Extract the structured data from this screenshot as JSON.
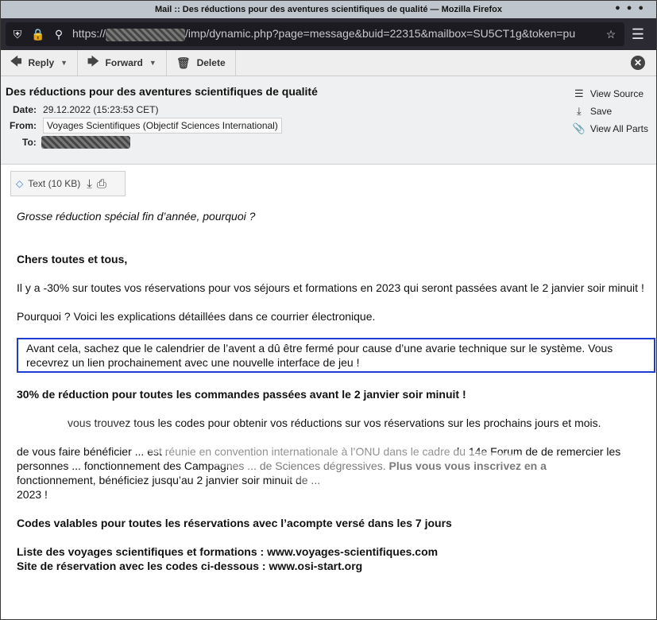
{
  "window": {
    "title": "Mail :: Des réductions pour des aventures scientifiques de qualité — Mozilla Firefox"
  },
  "browser": {
    "url_prefix": "https://",
    "url_suffix": "/imp/dynamic.php?page=message&buid=22315&mailbox=SU5CT1g&token=pu",
    "icons": [
      "shield-icon",
      "lock-icon",
      "permissions-icon",
      "bookmark-star-icon",
      "hamburger-menu-icon"
    ]
  },
  "toolbar": {
    "reply_label": "Reply",
    "forward_label": "Forward",
    "delete_label": "Delete"
  },
  "message": {
    "subject": "Des réductions pour des aventures scientifiques de qualité",
    "date_label": "Date:",
    "date_value": "29.12.2022 (15:23:53 CET)",
    "from_label": "From:",
    "from_value": "Voyages Scientifiques (Objectif Sciences International)",
    "to_label": "To:",
    "links": {
      "view_source": "View Source",
      "save": "Save",
      "view_all_parts": "View All Parts"
    }
  },
  "attachment": {
    "label": "Text (10 KB)"
  },
  "body": {
    "intro": "Grosse réduction spécial fin d’année, pourquoi ?",
    "greeting": "Chers toutes et tous,",
    "p1": "Il y a -30% sur toutes vos réservations pour vos séjours et formations en 2023 qui seront passées avant le 2 janvier soir minuit !",
    "p2": "Pourquoi ? Voici les explications détaillées dans ce courrier électronique.",
    "p3": "Avant cela, sachez que le calendrier de l’avent a dû être fermé pour cause d’une avarie technique sur le système. Vous recevrez un lien prochainement avec une nouvelle interface de jeu !",
    "heading1": "30% de réduction pour toutes les commandes passées avant le 2 janvier soir minuit !",
    "p4": "vous trouvez tous les codes pour obtenir vos réductions sur vos réservations sur les prochains jours et mois.",
    "p5a": "de vous faire bénéficier ... est réunie en convention internationale à l’ONU dans le cadre du 14e Forum de de remercier les personnes ... fonctionnement des Campagnes ... de Sciences dégressives.",
    "p5b": "Plus vous vous inscrivez en a",
    "p5c": "fonctionnement, bénéficiez jusqu’au 2 janvier soir minuit de ...",
    "p5d": "2023 !",
    "heading2": "Codes valables pour toutes les réservations avec l’acompte versé dans les 7 jours",
    "line1": "Liste des voyages scientifiques et formations : www.voyages-scientifiques.com",
    "line2": "Site de réservation avec les codes ci-dessous : www.osi-start.org"
  },
  "colors": {
    "highlight_border": "#1f3ed1",
    "urlbar_bg": "#2b2a33"
  }
}
